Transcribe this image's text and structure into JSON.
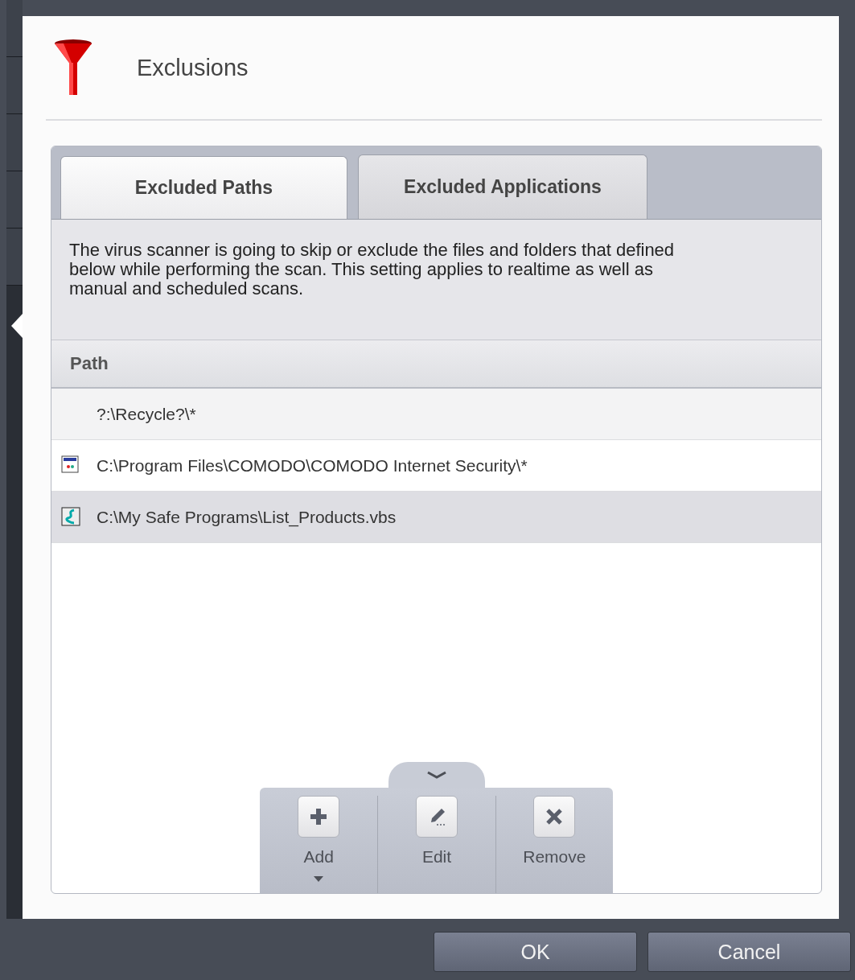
{
  "dialog": {
    "title": "Exclusions"
  },
  "tabs": [
    {
      "label": "Excluded Paths",
      "selected": true
    },
    {
      "label": "Excluded Applications",
      "selected": false
    }
  ],
  "description": "The virus scanner is going to skip or exclude the files and folders that defined below while performing the scan. This setting applies to realtime as well as manual and scheduled scans.",
  "table": {
    "columns": [
      "Path"
    ],
    "rows": [
      {
        "path": "?:\\Recycle?\\*",
        "kind": "plain",
        "selected": false
      },
      {
        "path": "C:\\Program Files\\COMODO\\COMODO Internet Security\\*",
        "kind": "window",
        "selected": false
      },
      {
        "path": "C:\\My Safe Programs\\List_Products.vbs",
        "kind": "script",
        "selected": true
      }
    ]
  },
  "toolbar": [
    {
      "label": "Add",
      "kind": "add"
    },
    {
      "label": "Edit",
      "kind": "edit"
    },
    {
      "label": "Remove",
      "kind": "remove"
    }
  ],
  "buttons": [
    "OK",
    "Cancel"
  ]
}
